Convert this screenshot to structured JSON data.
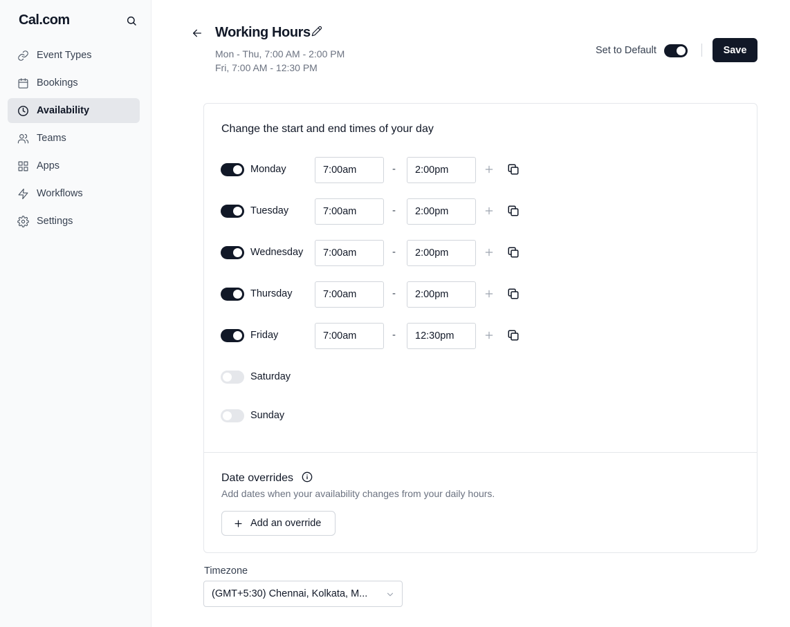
{
  "sidebar": {
    "logo": "Cal.com",
    "items": [
      {
        "label": "Event Types",
        "icon": "link-icon"
      },
      {
        "label": "Bookings",
        "icon": "calendar-icon"
      },
      {
        "label": "Availability",
        "icon": "clock-icon",
        "active": true
      },
      {
        "label": "Teams",
        "icon": "users-icon"
      },
      {
        "label": "Apps",
        "icon": "grid-icon"
      },
      {
        "label": "Workflows",
        "icon": "zap-icon"
      },
      {
        "label": "Settings",
        "icon": "gear-icon"
      }
    ]
  },
  "header": {
    "title": "Working Hours",
    "summary_line1": "Mon - Thu, 7:00 AM - 2:00 PM",
    "summary_line2": "Fri, 7:00 AM - 12:30 PM",
    "set_default_label": "Set to Default",
    "set_default_on": true,
    "save_label": "Save"
  },
  "schedule": {
    "heading": "Change the start and end times of your day",
    "separator": "-",
    "days": [
      {
        "name": "Monday",
        "enabled": true,
        "start": "7:00am",
        "end": "2:00pm"
      },
      {
        "name": "Tuesday",
        "enabled": true,
        "start": "7:00am",
        "end": "2:00pm"
      },
      {
        "name": "Wednesday",
        "enabled": true,
        "start": "7:00am",
        "end": "2:00pm"
      },
      {
        "name": "Thursday",
        "enabled": true,
        "start": "7:00am",
        "end": "2:00pm"
      },
      {
        "name": "Friday",
        "enabled": true,
        "start": "7:00am",
        "end": "12:30pm"
      },
      {
        "name": "Saturday",
        "enabled": false
      },
      {
        "name": "Sunday",
        "enabled": false
      }
    ]
  },
  "overrides": {
    "title": "Date overrides",
    "description": "Add dates when your availability changes from your daily hours.",
    "add_label": "Add an override"
  },
  "timezone": {
    "label": "Timezone",
    "value": "(GMT+5:30) Chennai, Kolkata, M..."
  },
  "colors": {
    "primary": "#111827",
    "sidebar_bg": "#f9fafb",
    "active_nav_bg": "#e5e7eb",
    "muted_text": "#6b7280"
  }
}
